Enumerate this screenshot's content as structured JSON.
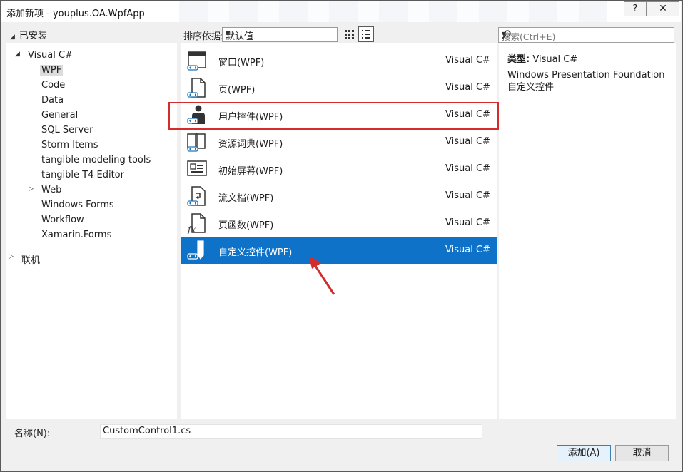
{
  "window": {
    "title": "添加新项 - youplus.OA.WpfApp",
    "help": "?",
    "close": "✕"
  },
  "left": {
    "header": "已安装",
    "tree": [
      {
        "label": "Visual C#",
        "expander": "◢"
      },
      {
        "label": "WPF"
      },
      {
        "label": "Code"
      },
      {
        "label": "Data"
      },
      {
        "label": "General"
      },
      {
        "label": "SQL Server"
      },
      {
        "label": "Storm Items"
      },
      {
        "label": "tangible modeling tools"
      },
      {
        "label": "tangible T4 Editor"
      },
      {
        "label": "Web",
        "expander": "▷"
      },
      {
        "label": "Windows Forms"
      },
      {
        "label": "Workflow"
      },
      {
        "label": "Xamarin.Forms"
      }
    ],
    "online": {
      "label": "联机",
      "expander": "▷"
    }
  },
  "toolbar": {
    "sort_label": "排序依据:",
    "sort_value": "默认值",
    "search_placeholder": "搜索(Ctrl+E)"
  },
  "items": [
    {
      "name": "窗口(WPF)",
      "lang": "Visual C#",
      "icon": "window-icon"
    },
    {
      "name": "页(WPF)",
      "lang": "Visual C#",
      "icon": "page-icon"
    },
    {
      "name": "用户控件(WPF)",
      "lang": "Visual C#",
      "icon": "user-control-icon"
    },
    {
      "name": "资源词典(WPF)",
      "lang": "Visual C#",
      "icon": "resource-dictionary-icon"
    },
    {
      "name": "初始屏幕(WPF)",
      "lang": "Visual C#",
      "icon": "splash-screen-icon"
    },
    {
      "name": "流文档(WPF)",
      "lang": "Visual C#",
      "icon": "flow-document-icon"
    },
    {
      "name": "页函数(WPF)",
      "lang": "Visual C#",
      "icon": "page-function-icon"
    },
    {
      "name": "自定义控件(WPF)",
      "lang": "Visual C#",
      "icon": "custom-control-icon"
    }
  ],
  "details": {
    "type_label": "类型:",
    "type_value": "Visual C#",
    "description": "Windows Presentation Foundation 自定义控件"
  },
  "footer": {
    "name_label": "名称(N):",
    "name_value": "CustomControl1.cs",
    "add_label": "添加(A)",
    "cancel_label": "取消"
  },
  "colors": {
    "selection": "#0e72c8",
    "highlight_box": "#d22c2c",
    "arrow": "#d22c2c"
  }
}
